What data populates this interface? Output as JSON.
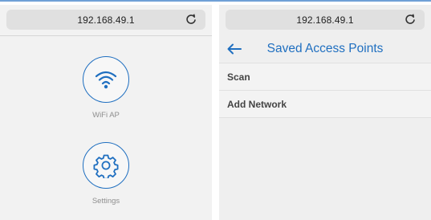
{
  "colors": {
    "accent": "#1f6fc0",
    "label_gray": "#8f8f8f",
    "url_bar_bg": "#e0e0e0",
    "panel_bg": "#f2f2f2"
  },
  "left_screen": {
    "url": "192.168.49.1",
    "reload_icon": "reload-icon",
    "apps": [
      {
        "label": "WiFi AP",
        "icon": "wifi-icon"
      },
      {
        "label": "Settings",
        "icon": "gear-icon"
      }
    ]
  },
  "right_screen": {
    "url": "192.168.49.1",
    "reload_icon": "reload-icon",
    "back_icon": "back-arrow-icon",
    "title": "Saved Access Points",
    "items": [
      {
        "label": "Scan"
      },
      {
        "label": "Add Network"
      }
    ]
  }
}
